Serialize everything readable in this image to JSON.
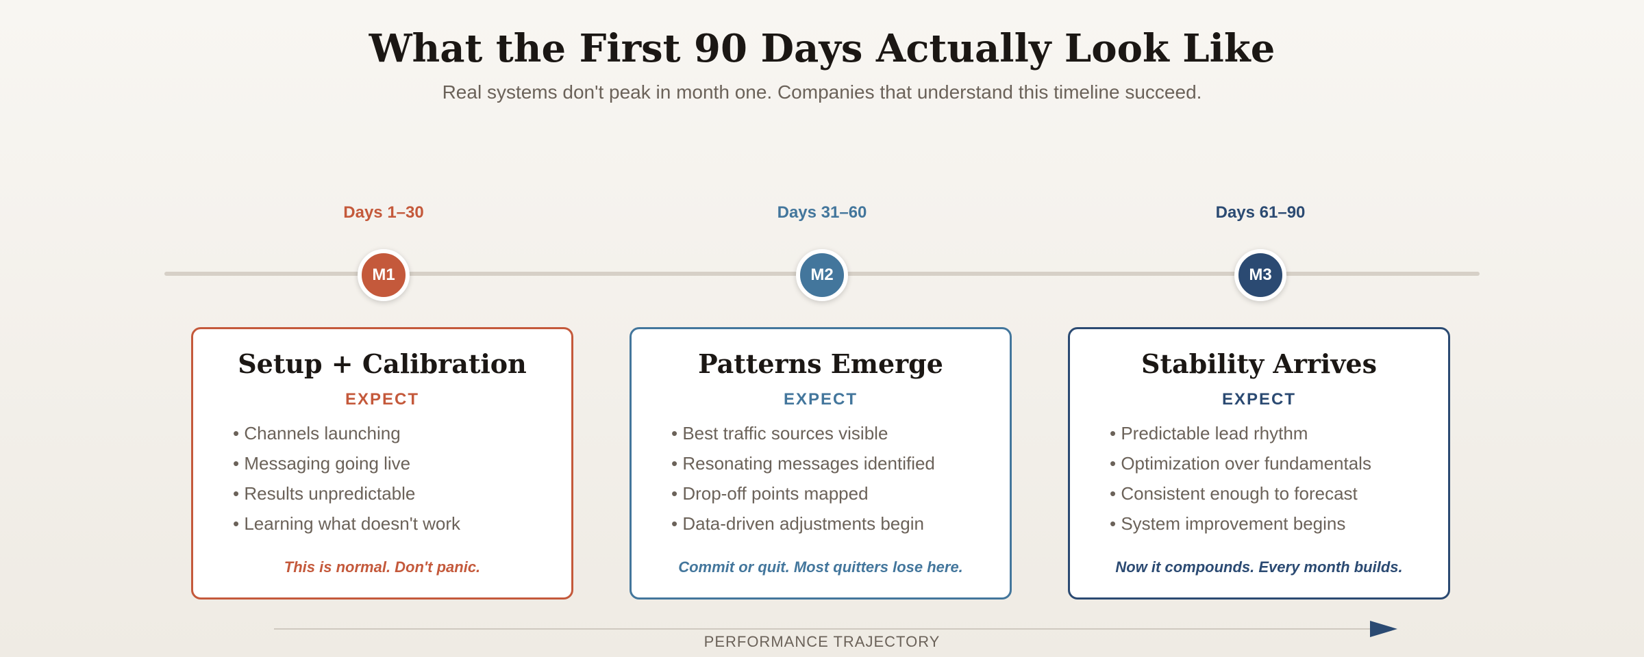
{
  "header": {
    "title": "What the First 90 Days Actually Look Like",
    "subtitle": "Real systems don't peak in month one. Companies that understand this timeline succeed."
  },
  "colors": {
    "m1": "#c4593b",
    "m2": "#43769c",
    "m3": "#2b4a72"
  },
  "phases": [
    {
      "days": "Days 1–30",
      "badge": "M1",
      "title": "Setup + Calibration",
      "expect": "EXPECT",
      "bullets": [
        "Channels launching",
        "Messaging going live",
        "Results unpredictable",
        "Learning what doesn't work"
      ],
      "note": "This is normal. Don't panic."
    },
    {
      "days": "Days 31–60",
      "badge": "M2",
      "title": "Patterns Emerge",
      "expect": "EXPECT",
      "bullets": [
        "Best traffic sources visible",
        "Resonating messages identified",
        "Drop-off points mapped",
        "Data-driven adjustments begin"
      ],
      "note": "Commit or quit. Most quitters lose here."
    },
    {
      "days": "Days 61–90",
      "badge": "M3",
      "title": "Stability Arrives",
      "expect": "EXPECT",
      "bullets": [
        "Predictable lead rhythm",
        "Optimization over fundamentals",
        "Consistent enough to forecast",
        "System improvement begins"
      ],
      "note": "Now it compounds. Every month builds."
    }
  ],
  "trajectory": {
    "label": "PERFORMANCE TRAJECTORY"
  }
}
